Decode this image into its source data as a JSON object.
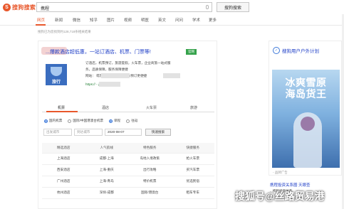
{
  "header": {
    "logo_text": "搜狗搜索",
    "search_value": "携程",
    "search_button": "搜狗搜索"
  },
  "tabs": [
    {
      "label": "网页",
      "active": true
    },
    {
      "label": "新闻"
    },
    {
      "label": "微信"
    },
    {
      "label": "知乎"
    },
    {
      "label": "图片"
    },
    {
      "label": "视频"
    },
    {
      "label": "明医"
    },
    {
      "label": "英文"
    },
    {
      "label": "问问"
    },
    {
      "label": "学术"
    },
    {
      "label": "更多"
    }
  ],
  "result_count": "搜狗已为您找到约128,718条相关结果",
  "ad": {
    "title": "...爆款酒店超低惠，一站订酒店、机票、门票等!",
    "badge": "官网",
    "logo_text": "旅行",
    "desc_lines": [
      "订酒店，机票预订，旅游度假，火车票，企业商旅一站式服",
      "务，品质保障，服务保障便捷",
      "网站：                           或热线咨询：4            下载app预订更便捷",
      "https://           ... 品牌广告"
    ],
    "link": "https://           - 品牌广告"
  },
  "booking": {
    "tabs": [
      {
        "label": "机票",
        "active": true
      },
      {
        "label": "酒店"
      },
      {
        "label": "火车票"
      },
      {
        "label": "旅游"
      }
    ],
    "radio_options": [
      {
        "label": "国内机票",
        "checked": true
      },
      {
        "label": "国际/中国港澳台机票"
      },
      {
        "label": "单程",
        "checked": true
      },
      {
        "label": "往返"
      }
    ],
    "from_placeholder": "出发城市",
    "to_placeholder": "到达城市",
    "date_value": "2020-08-07",
    "search_button": "快速搜索"
  },
  "service_table": {
    "headers": [
      "精选酒店",
      "人气航线",
      "特色服务",
      "快捷服务"
    ],
    "rows": [
      [
        "上海酒店",
        "成都-上海",
        "岛地入境政策",
        "抢火车票"
      ],
      [
        "西安酒店",
        "上海-重庆",
        "出行攻略",
        "买汽车票"
      ],
      [
        "广州酒店",
        "上海-青岛",
        "特价机票",
        "优选民宿"
      ],
      [
        "杭州酒店",
        "深圳-成都",
        "国际/港澳台",
        "租车专车"
      ]
    ]
  },
  "sidebar": {
    "title": "搜狗用户户外计划",
    "poster_line1": "冰爽雪原",
    "poster_line2": "海岛货王",
    "ad_label": "- 品牌广告",
    "promo_title": "携程投资关系圈 天眼查",
    "promo_sub": "...携程投资关系"
  },
  "watermark": "搜狐号@丝路贸易港"
}
